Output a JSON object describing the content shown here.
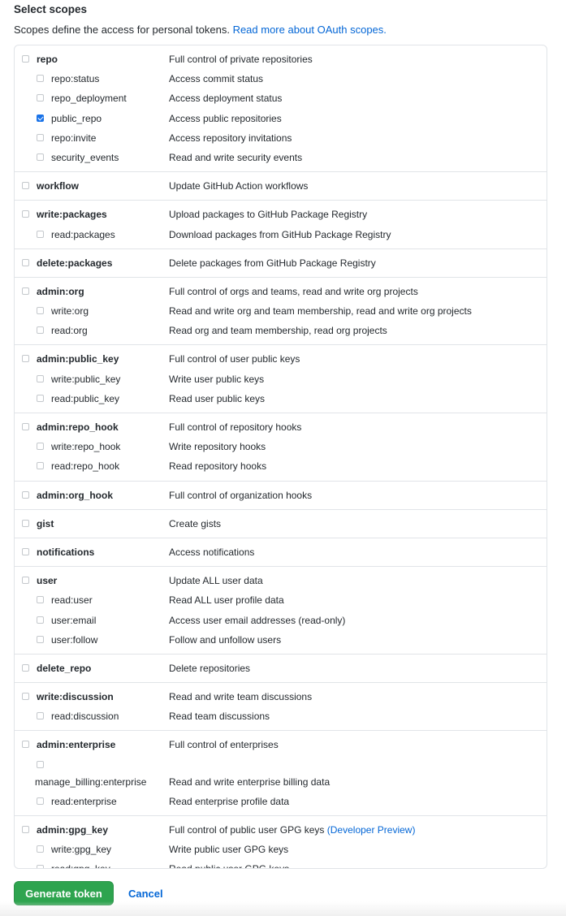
{
  "section": {
    "heading": "Select scopes",
    "description": "Scopes define the access for personal tokens.",
    "link_text": "Read more about OAuth scopes."
  },
  "groups": [
    {
      "id": "repo",
      "parent": {
        "name": "repo",
        "desc": "Full control of private repositories",
        "checked": false
      },
      "children": [
        {
          "name": "repo:status",
          "desc": "Access commit status",
          "checked": false
        },
        {
          "name": "repo_deployment",
          "desc": "Access deployment status",
          "checked": false
        },
        {
          "name": "public_repo",
          "desc": "Access public repositories",
          "checked": true
        },
        {
          "name": "repo:invite",
          "desc": "Access repository invitations",
          "checked": false
        },
        {
          "name": "security_events",
          "desc": "Read and write security events",
          "checked": false
        }
      ]
    },
    {
      "id": "workflow",
      "parent": {
        "name": "workflow",
        "desc": "Update GitHub Action workflows",
        "checked": false
      },
      "children": []
    },
    {
      "id": "write-packages",
      "parent": {
        "name": "write:packages",
        "desc": "Upload packages to GitHub Package Registry",
        "checked": false
      },
      "children": [
        {
          "name": "read:packages",
          "desc": "Download packages from GitHub Package Registry",
          "checked": false
        }
      ]
    },
    {
      "id": "delete-packages",
      "parent": {
        "name": "delete:packages",
        "desc": "Delete packages from GitHub Package Registry",
        "checked": false
      },
      "children": []
    },
    {
      "id": "admin-org",
      "parent": {
        "name": "admin:org",
        "desc": "Full control of orgs and teams, read and write org projects",
        "checked": false
      },
      "children": [
        {
          "name": "write:org",
          "desc": "Read and write org and team membership, read and write org projects",
          "checked": false
        },
        {
          "name": "read:org",
          "desc": "Read org and team membership, read org projects",
          "checked": false
        }
      ]
    },
    {
      "id": "admin-public-key",
      "parent": {
        "name": "admin:public_key",
        "desc": "Full control of user public keys",
        "checked": false
      },
      "children": [
        {
          "name": "write:public_key",
          "desc": "Write user public keys",
          "checked": false
        },
        {
          "name": "read:public_key",
          "desc": "Read user public keys",
          "checked": false
        }
      ]
    },
    {
      "id": "admin-repo-hook",
      "parent": {
        "name": "admin:repo_hook",
        "desc": "Full control of repository hooks",
        "checked": false
      },
      "children": [
        {
          "name": "write:repo_hook",
          "desc": "Write repository hooks",
          "checked": false
        },
        {
          "name": "read:repo_hook",
          "desc": "Read repository hooks",
          "checked": false
        }
      ]
    },
    {
      "id": "admin-org-hook",
      "parent": {
        "name": "admin:org_hook",
        "desc": "Full control of organization hooks",
        "checked": false
      },
      "children": []
    },
    {
      "id": "gist",
      "parent": {
        "name": "gist",
        "desc": "Create gists",
        "checked": false
      },
      "children": []
    },
    {
      "id": "notifications",
      "parent": {
        "name": "notifications",
        "desc": "Access notifications",
        "checked": false
      },
      "children": []
    },
    {
      "id": "user",
      "parent": {
        "name": "user",
        "desc": "Update ALL user data",
        "checked": false
      },
      "children": [
        {
          "name": "read:user",
          "desc": "Read ALL user profile data",
          "checked": false
        },
        {
          "name": "user:email",
          "desc": "Access user email addresses (read-only)",
          "checked": false
        },
        {
          "name": "user:follow",
          "desc": "Follow and unfollow users",
          "checked": false
        }
      ]
    },
    {
      "id": "delete-repo",
      "parent": {
        "name": "delete_repo",
        "desc": "Delete repositories",
        "checked": false
      },
      "children": []
    },
    {
      "id": "write-discussion",
      "parent": {
        "name": "write:discussion",
        "desc": "Read and write team discussions",
        "checked": false
      },
      "children": [
        {
          "name": "read:discussion",
          "desc": "Read team discussions",
          "checked": false
        }
      ]
    },
    {
      "id": "admin-enterprise",
      "parent": {
        "name": "admin:enterprise",
        "desc": "Full control of enterprises",
        "checked": false
      },
      "children": [
        {
          "name": "manage_billing:enterprise",
          "desc": "Read and write enterprise billing data",
          "checked": false,
          "wrapped": true
        },
        {
          "name": "read:enterprise",
          "desc": "Read enterprise profile data",
          "checked": false
        }
      ]
    },
    {
      "id": "admin-gpg-key",
      "parent": {
        "name": "admin:gpg_key",
        "desc": "Full control of public user GPG keys",
        "desc_extra": "(Developer Preview)",
        "checked": false
      },
      "children": [
        {
          "name": "write:gpg_key",
          "desc": "Write public user GPG keys",
          "checked": false
        },
        {
          "name": "read:gpg_key",
          "desc": "Read public user GPG keys",
          "checked": false
        }
      ]
    }
  ],
  "actions": {
    "generate_label": "Generate token",
    "cancel_label": "Cancel"
  },
  "colors": {
    "primary_button": "#2ea44f",
    "link": "#0366d6",
    "checkbox_checked": "#1a73e8",
    "border": "#e1e4e8"
  }
}
